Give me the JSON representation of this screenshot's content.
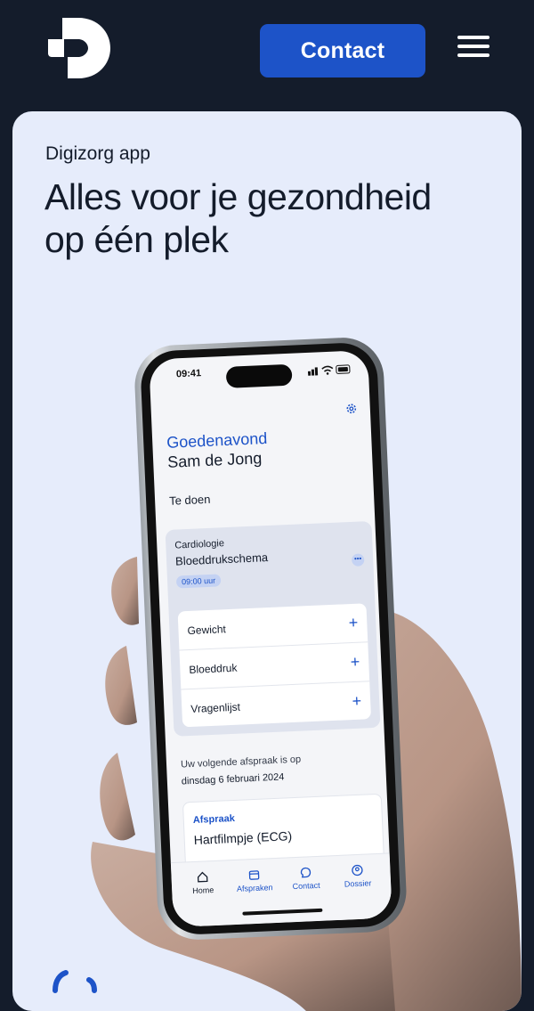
{
  "nav": {
    "contact_label": "Contact"
  },
  "hero": {
    "eyebrow": "Digizorg app",
    "headline": "Alles voor je gezondheid op één plek"
  },
  "phone": {
    "time": "09:41",
    "greeting": "Goedenavond",
    "user_name": "Sam de Jong",
    "todo_heading": "Te doen",
    "task": {
      "category": "Cardiologie",
      "title": "Bloeddrukschema",
      "time": "09:00 uur",
      "items": [
        {
          "label": "Gewicht"
        },
        {
          "label": "Bloeddruk"
        },
        {
          "label": "Vragenlijst"
        }
      ]
    },
    "next_appointment_line1": "Uw volgende afspraak is op",
    "next_appointment_line2": "dinsdag 6 februari 2024",
    "appointment": {
      "label": "Afspraak",
      "title": "Hartfilmpje (ECG)"
    },
    "tabs": [
      {
        "label": "Home"
      },
      {
        "label": "Afspraken"
      },
      {
        "label": "Contact"
      },
      {
        "label": "Dossier"
      }
    ]
  },
  "colors": {
    "background": "#141c2b",
    "accent": "#1d53c8",
    "card": "#e6ecfb"
  },
  "icons": {
    "logo": "digizorg-logo-icon",
    "menu": "hamburger-menu-icon",
    "settings": "gear-icon",
    "plus": "plus-icon"
  }
}
